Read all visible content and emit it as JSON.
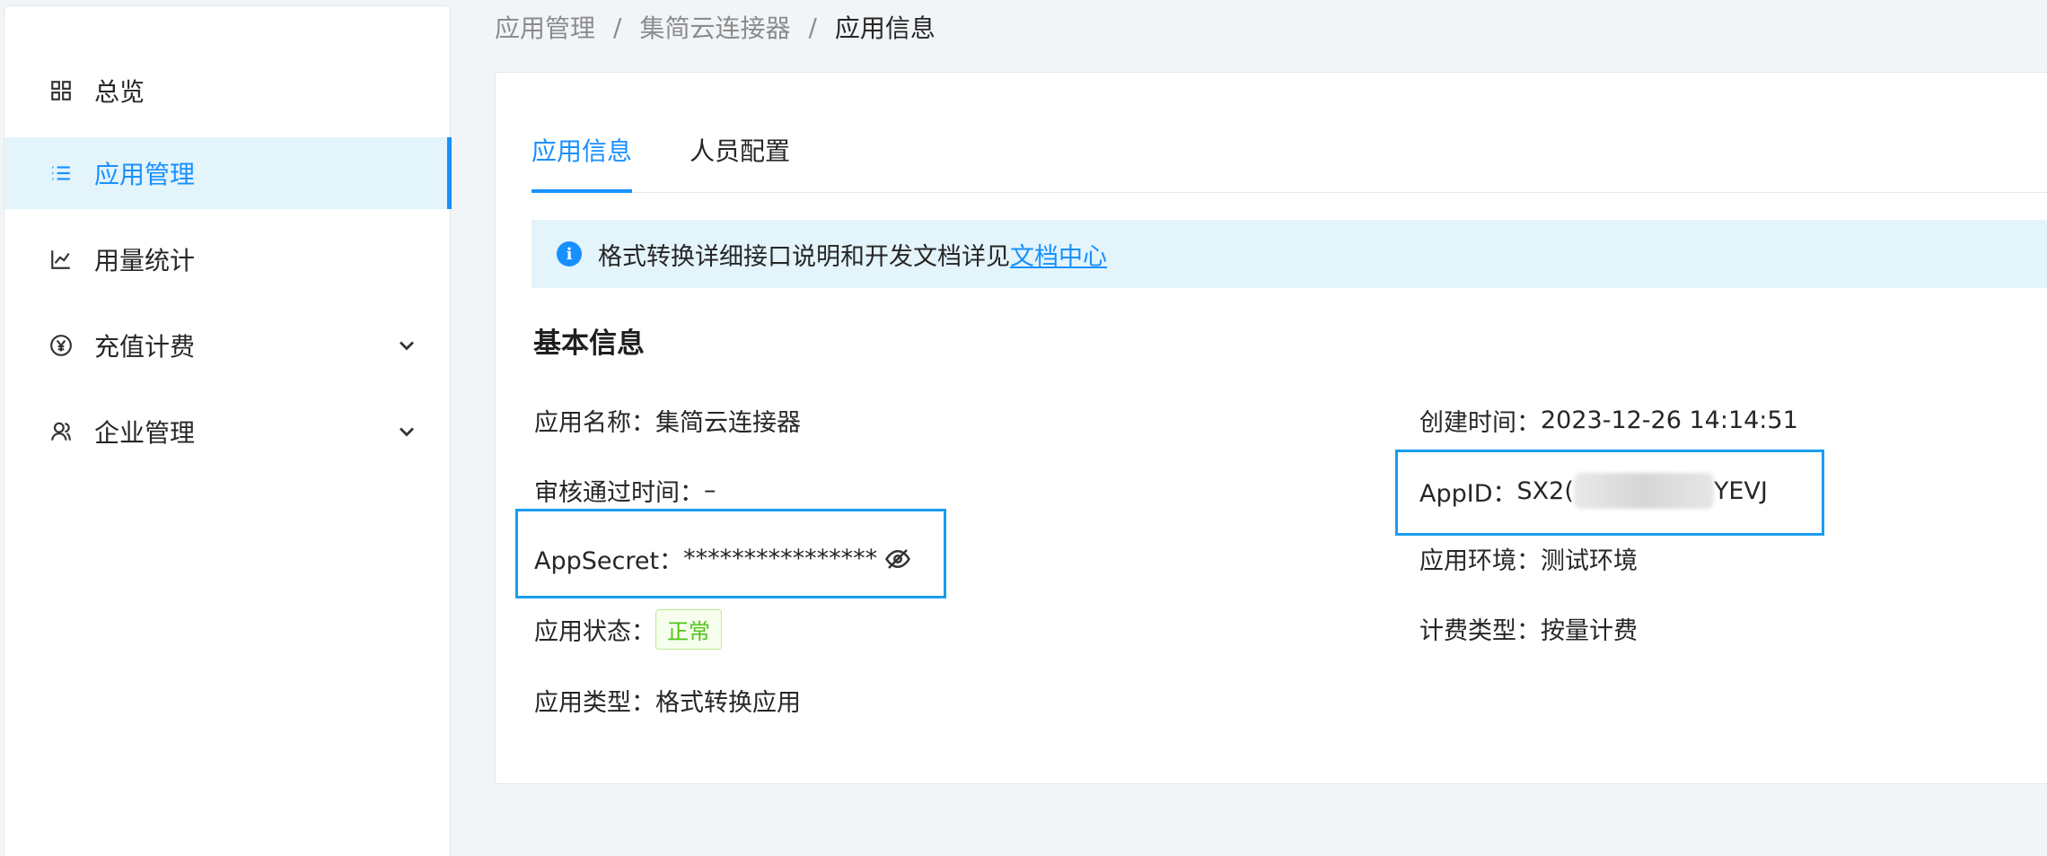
{
  "sidebar": {
    "items": [
      {
        "label": "总览",
        "icon": "grid-icon"
      },
      {
        "label": "应用管理",
        "icon": "list-icon",
        "active": true
      },
      {
        "label": "用量统计",
        "icon": "line-chart-icon"
      },
      {
        "label": "充值计费",
        "icon": "yen-circle-icon",
        "expandable": true
      },
      {
        "label": "企业管理",
        "icon": "user-group-icon",
        "expandable": true
      }
    ]
  },
  "breadcrumb": {
    "items": [
      "应用管理",
      "集简云连接器",
      "应用信息"
    ],
    "separator": "/"
  },
  "tabs": [
    {
      "label": "应用信息",
      "active": true
    },
    {
      "label": "人员配置",
      "active": false
    }
  ],
  "alert": {
    "text": "格式转换详细接口说明和开发文档详见",
    "link": "文档中心"
  },
  "basic_info": {
    "title": "基本信息",
    "app_name": {
      "label": "应用名称：",
      "value": "集简云连接器"
    },
    "approval_time": {
      "label": "审核通过时间：",
      "value": "–"
    },
    "app_secret": {
      "label": "AppSecret：",
      "value": "****************"
    },
    "app_status": {
      "label": "应用状态：",
      "value": "正常"
    },
    "app_type": {
      "label": "应用类型：",
      "value": "格式转换应用"
    },
    "created_time": {
      "label": "创建时间：",
      "value": "2023-12-26 14:14:51"
    },
    "app_id": {
      "label": "AppID：",
      "prefix": "SX2(",
      "suffix": "YEVJ"
    },
    "app_env": {
      "label": "应用环境：",
      "value": "测试环境"
    },
    "billing_type": {
      "label": "计费类型：",
      "value": "按量计费"
    }
  },
  "colors": {
    "accent": "#1890ff",
    "highlight": "#1a9cf0",
    "success": "#52c41a"
  }
}
